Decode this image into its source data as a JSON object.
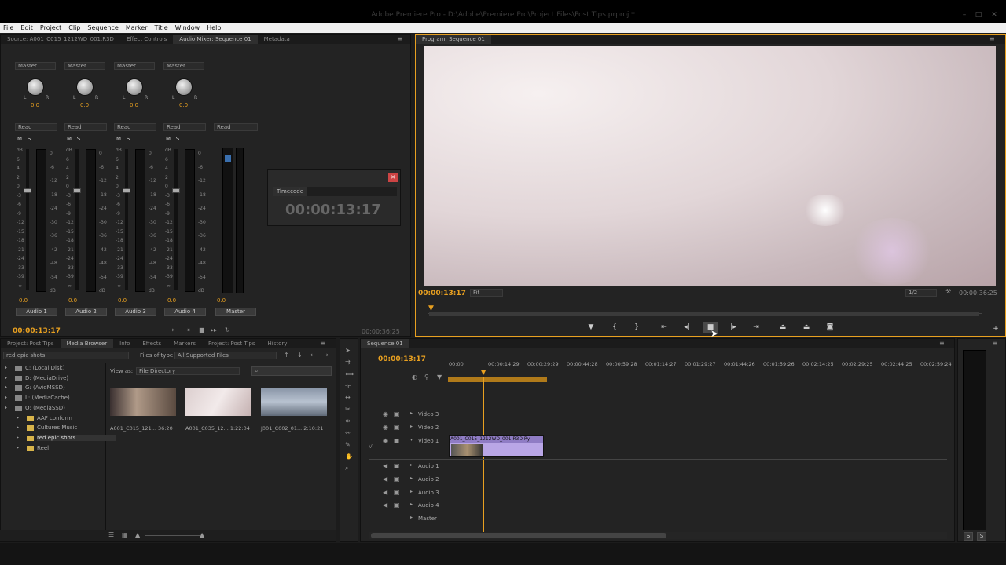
{
  "app": {
    "title": "Adobe Premiere Pro - D:\\Adobe\\Premiere Pro\\Project Files\\Post Tips.prproj *"
  },
  "menu": [
    "File",
    "Edit",
    "Project",
    "Clip",
    "Sequence",
    "Marker",
    "Title",
    "Window",
    "Help"
  ],
  "source_panel": {
    "tabs": [
      "Source: A001_C015_1212WD_001.R3D",
      "Effect Controls",
      "Audio Mixer: Sequence 01",
      "Metadata"
    ],
    "channels": [
      {
        "output": "Master",
        "pan": "0.0",
        "mode": "Read",
        "vol": "0.0",
        "name": "Audio 1",
        "fader": 0.28
      },
      {
        "output": "Master",
        "pan": "0.0",
        "mode": "Read",
        "vol": "0.0",
        "name": "Audio 2",
        "fader": 0.28
      },
      {
        "output": "Master",
        "pan": "0.0",
        "mode": "Read",
        "vol": "0.0",
        "name": "Audio 3",
        "fader": 0.28
      },
      {
        "output": "Master",
        "pan": "0.0",
        "mode": "Read",
        "vol": "0.0",
        "name": "Audio 4",
        "fader": 0.28
      }
    ],
    "master": {
      "mode": "Read",
      "vol": "0.0",
      "name": "Master"
    },
    "timecode_in": "00:00:13:17",
    "timecode_dur": "00:00:36:25"
  },
  "timecode_window": {
    "tab": "Timecode",
    "value": "00:00:13:17"
  },
  "program": {
    "tab": "Program: Sequence 01",
    "timecode": "00:00:13:17",
    "fit": "Fit",
    "resolution": "1/2",
    "duration": "00:00:36:25"
  },
  "project_panel": {
    "tabs": [
      "Project: Post Tips",
      "Media Browser",
      "Info",
      "Effects",
      "Markers",
      "Project: Post Tips",
      "History"
    ],
    "location": "red epic shots",
    "files_of_type_label": "Files of type:",
    "files_of_type": "All Supported Files",
    "view_as_label": "View as:",
    "view_as": "File Directory",
    "tree": [
      {
        "label": "C: (Local Disk)",
        "indent": 0
      },
      {
        "label": "D: (MediaDrive)",
        "indent": 0
      },
      {
        "label": "G: (AvidMSSD)",
        "indent": 0
      },
      {
        "label": "L: (MediaCache)",
        "indent": 0
      },
      {
        "label": "Q: (MediaSSD)",
        "indent": 0
      },
      {
        "label": "AAF conform",
        "indent": 1
      },
      {
        "label": "Cultures Music",
        "indent": 1
      },
      {
        "label": "red epic shots",
        "indent": 1
      },
      {
        "label": "Reel",
        "indent": 1
      }
    ],
    "thumbs": [
      {
        "label": "A001_C015_121...  36:20"
      },
      {
        "label": "A001_C035_12...  1:22:04"
      },
      {
        "label": "J001_C002_01...  2:10:21"
      }
    ]
  },
  "timeline": {
    "tab": "Sequence 01",
    "timecode": "00:00:13:17",
    "ruler": [
      "00:00",
      "00:00:14:29",
      "00:00:29:29",
      "00:00:44:28",
      "00:00:59:28",
      "00:01:14:27",
      "00:01:29:27",
      "00:01:44:26",
      "00:01:59:26",
      "00:02:14:25",
      "00:02:29:25",
      "00:02:44:25",
      "00:02:59:24"
    ],
    "video_tracks": [
      "Video 3",
      "Video 2",
      "Video 1"
    ],
    "audio_tracks": [
      "Audio 1",
      "Audio 2",
      "Audio 3",
      "Audio 4",
      "Master"
    ],
    "clip_label": "A001_C015_1212WD_001.R3D  Ry",
    "v_label": "V"
  },
  "master_meter": {
    "left": "S",
    "right": "S"
  },
  "colors": {
    "accent": "#e8a020",
    "clip": "#b9a6e6"
  }
}
